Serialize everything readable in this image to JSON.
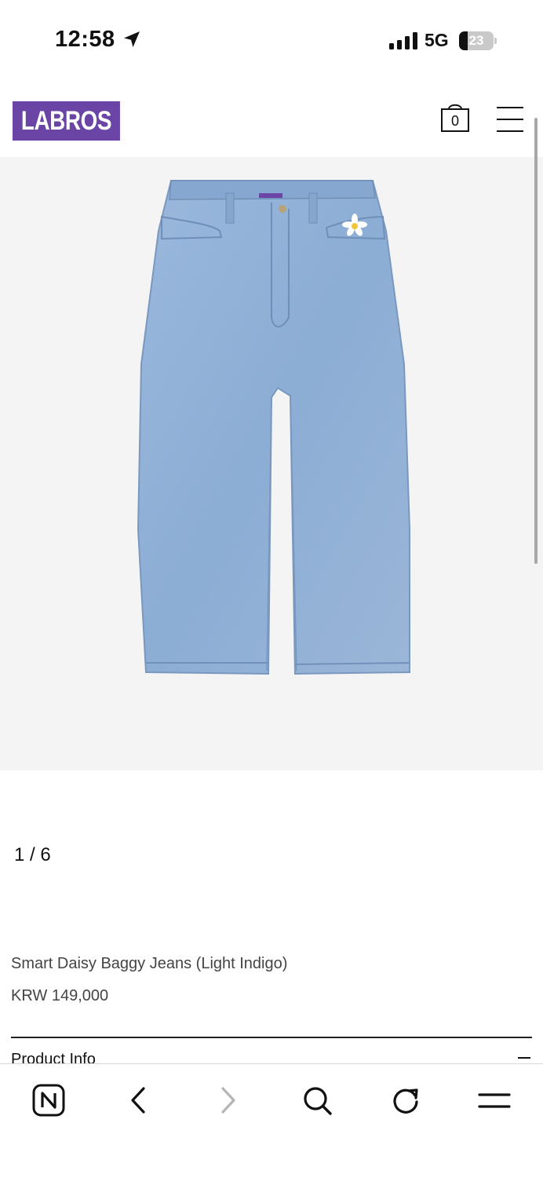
{
  "status_bar": {
    "time": "12:58",
    "network": "5G",
    "battery": "23"
  },
  "header": {
    "logo": "LABROS",
    "cart_count": "0"
  },
  "gallery": {
    "pager": "1 / 6"
  },
  "product": {
    "name": "Smart Daisy Baggy Jeans (Light Indigo)",
    "price": "KRW 149,000"
  },
  "sections": {
    "product_info": "Product Info"
  },
  "colors": {
    "brand": "#6a45a6",
    "image_background": "#f4f4f4",
    "denim": "#8fb0d6"
  },
  "toolbar": {
    "icons": [
      "naver-home-icon",
      "back-icon",
      "forward-icon",
      "search-icon",
      "reload-icon",
      "menu-icon"
    ]
  }
}
